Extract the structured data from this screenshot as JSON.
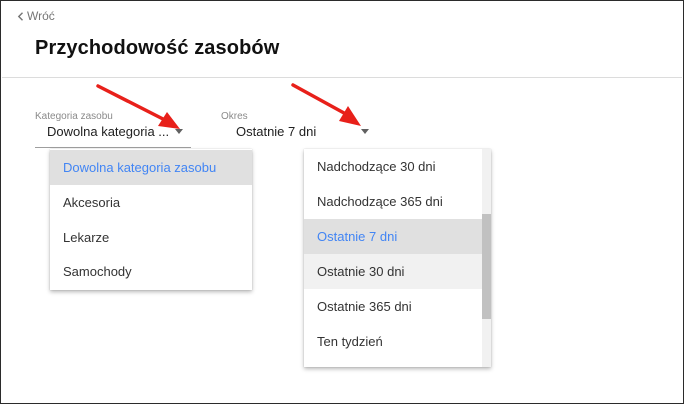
{
  "header": {
    "back_label": "Wróć",
    "title": "Przychodowość zasobów"
  },
  "filters": {
    "category": {
      "label": "Kategoria zasobu",
      "value": "Dowolna kategoria ..."
    },
    "period": {
      "label": "Okres",
      "value": "Ostatnie 7 dni"
    }
  },
  "category_menu": {
    "items": [
      "Dowolna kategoria zasobu",
      "Akcesoria",
      "Lekarze",
      "Samochody"
    ],
    "selected": "Dowolna kategoria zasobu"
  },
  "period_menu": {
    "items": [
      "Nadchodzące 30 dni",
      "Nadchodzące 365 dni",
      "Ostatnie 7 dni",
      "Ostatnie 30 dni",
      "Ostatnie 365 dni",
      "Ten tydzień"
    ],
    "selected": "Ostatnie 7 dni",
    "hovered": "Ostatnie 30 dni"
  },
  "colors": {
    "accent": "#4285f4",
    "annotation_arrow": "#e8201a",
    "selected_bg": "#e0e0e0"
  },
  "icons": {
    "back": "chevron-left-icon",
    "dropdown": "caret-down-icon",
    "annotation": "red-arrow-icon"
  }
}
